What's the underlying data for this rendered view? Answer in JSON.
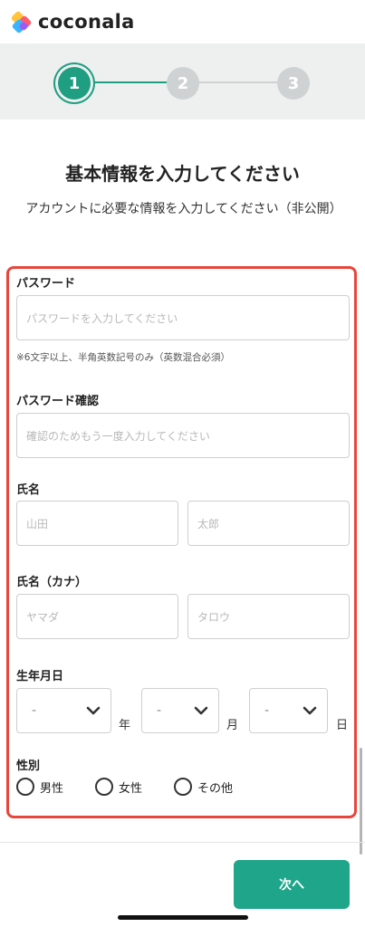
{
  "app": {
    "logo_text": "coconala"
  },
  "stepper": {
    "steps": [
      {
        "label": "1",
        "state": "active"
      },
      {
        "label": "2",
        "state": "inactive"
      },
      {
        "label": "3",
        "state": "inactive"
      }
    ],
    "active_color": "#1f9e82"
  },
  "page": {
    "title": "基本情報を入力してください",
    "subtitle": "アカウントに必要な情報を入力してください（非公開）"
  },
  "form": {
    "password": {
      "label": "パスワード",
      "placeholder": "パスワードを入力してください",
      "hint": "※6文字以上、半角英数記号のみ（英数混合必須）"
    },
    "password_confirm": {
      "label": "パスワード確認",
      "placeholder": "確認のためもう一度入力してください"
    },
    "name": {
      "label": "氏名",
      "last_placeholder": "山田",
      "first_placeholder": "太郎"
    },
    "name_kana": {
      "label": "氏名（カナ）",
      "last_placeholder": "ヤマダ",
      "first_placeholder": "タロウ"
    },
    "birthdate": {
      "label": "生年月日",
      "year_value": "-",
      "year_unit": "年",
      "month_value": "-",
      "month_unit": "月",
      "day_value": "-",
      "day_unit": "日"
    },
    "gender": {
      "label": "性別",
      "options": [
        "男性",
        "女性",
        "その他"
      ]
    },
    "highlight_color": "#e8463b"
  },
  "footer": {
    "next_label": "次へ",
    "button_color": "#1ea58a"
  }
}
